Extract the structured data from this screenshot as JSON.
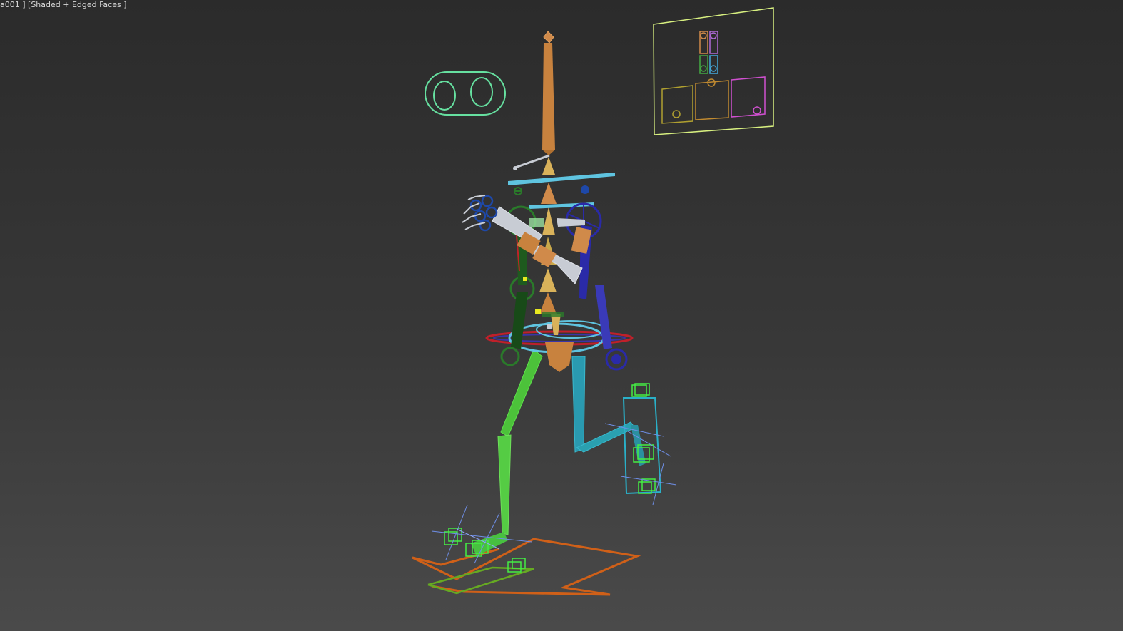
{
  "viewport": {
    "label": "a001 ] [Shaded + Edged Faces ]",
    "background_top": "#2b2b2b",
    "background_bottom": "#4a4a4a"
  },
  "rig_colors": {
    "spine": "#d08a4a",
    "spine_light": "#d9b25a",
    "neck_bar": "#5fc4e0",
    "left_arm": "#2a7a2a",
    "right_arm": "#2a2aa8",
    "left_leg": "#55cc44",
    "right_leg": "#2aa0b0",
    "hip_ring": "#c0202a",
    "foot_plate": "#d06018",
    "ik_box": "#44ee44",
    "panel_outline": "#d8f080",
    "eye_outline": "#66e0a0",
    "hand": "#c8ccd4"
  },
  "icons": {
    "eye_control": "eye-control-icon",
    "face_panel": "face-control-panel-icon"
  }
}
